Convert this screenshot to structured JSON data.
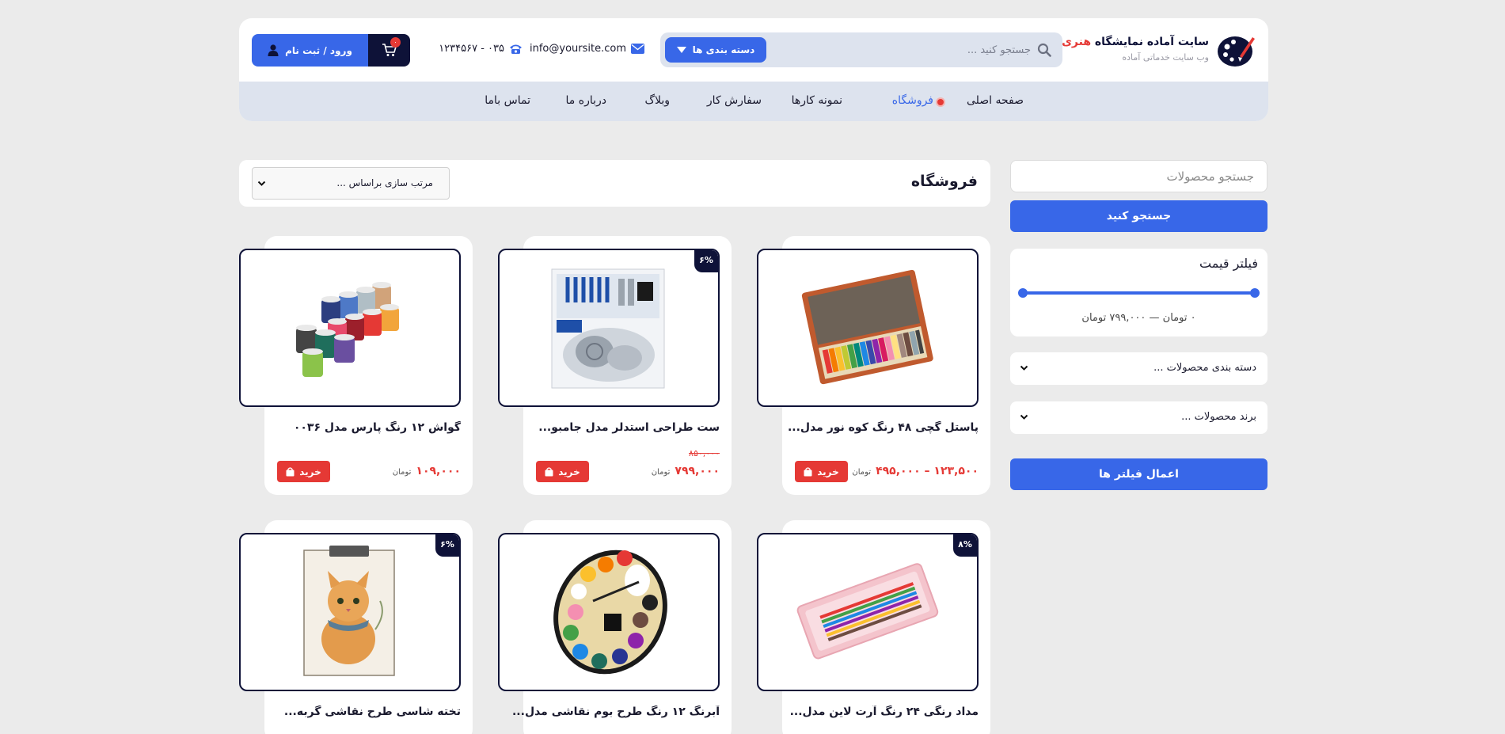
{
  "header": {
    "logo_title_main": "سایت آماده نمایشگاه",
    "logo_title_accent": "هنری",
    "logo_subtitle": "وب سایت خدماتی آماده",
    "search_placeholder": "جستجو کنید ...",
    "category_button": "دسته بندی ها",
    "email": "info@yoursite.com",
    "phone": "۰۳۵ - ۱۲۳۴۵۶۷",
    "cart_count": "۰",
    "login_label": "ورود / ثبت نام"
  },
  "nav": {
    "items": [
      {
        "label": "صفحه اصلی"
      },
      {
        "label": "فروشگاه"
      },
      {
        "label": "نمونه کارها"
      },
      {
        "label": "سفارش کار"
      },
      {
        "label": "وبلاگ"
      },
      {
        "label": "درباره ما"
      },
      {
        "label": "تماس باما"
      }
    ],
    "active_index": 1
  },
  "sidebar": {
    "search_placeholder": "جستجو محصولات",
    "search_button": "جستجو کنید",
    "price_filter_title": "فیلتر قیمت",
    "price_range_text": "۰ تومان — ۷۹۹,۰۰۰ تومان",
    "category_dropdown": "دسته بندی محصولات ...",
    "brand_dropdown": "برند محصولات ...",
    "apply_button": "اعمال فیلتر ها"
  },
  "shop": {
    "title": "فروشگاه",
    "sort_label": "مرتب سازی براساس ..."
  },
  "products": [
    {
      "title": "پاستل گچی ۴۸ رنگ کوه نور مدل...",
      "price": "۱۲۳,۵۰۰ – ۴۹۵,۰۰۰",
      "unit": "تومان",
      "old_price": "",
      "discount": "",
      "buy_label": "خرید",
      "image": "pastel-box"
    },
    {
      "title": "ست طراحی استدلر مدل جامبو...",
      "price": "۷۹۹,۰۰۰",
      "unit": "تومان",
      "old_price": "۸۵۰,۰۰۰",
      "discount": "۶%",
      "buy_label": "خرید",
      "image": "sketching-set"
    },
    {
      "title": "گواش ۱۲ رنگ پارس مدل ۰۰۳۶",
      "price": "۱۰۹,۰۰۰",
      "unit": "تومان",
      "old_price": "",
      "discount": "",
      "buy_label": "خرید",
      "image": "gouache-jars"
    },
    {
      "title": "مداد رنگی ۲۴ رنگ آرت لاین مدل...",
      "discount": "۸%",
      "image": "pencil-case"
    },
    {
      "title": "آبرنگ ۱۲ رنگ طرح بوم نقاشی مدل...",
      "discount": "",
      "image": "palette"
    },
    {
      "title": "تخته شاسی طرح نقاشی گربه...",
      "discount": "۶%",
      "image": "cat-clipboard"
    }
  ],
  "colors": {
    "primary": "#3867e8",
    "navy": "#0e1238",
    "red": "#e53935",
    "nav_bg": "#dde3ee",
    "page_bg": "#ebebeb"
  }
}
